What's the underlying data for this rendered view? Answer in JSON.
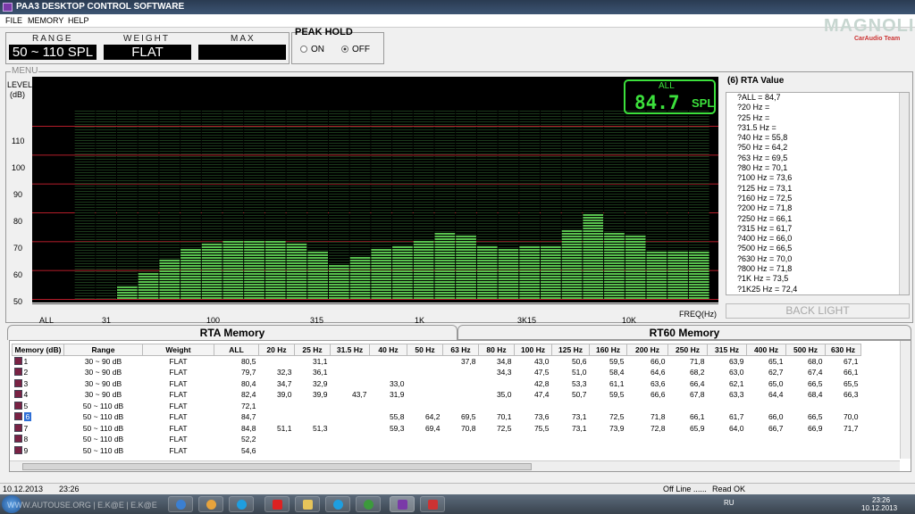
{
  "window": {
    "title": "PAA3 DESKTOP CONTROL SOFTWARE"
  },
  "menu": {
    "items": [
      "FILE",
      "MEMORY",
      "HELP"
    ]
  },
  "logo": {
    "brand": "MAGNOLIA",
    "sub": "CarAudio Team"
  },
  "top": {
    "range_label": "RANGE",
    "range_value": "50 ~ 110 SPL",
    "weight_label": "WEIGHT",
    "weight_value": "FLAT",
    "max_label": "MAX",
    "max_value": ""
  },
  "peak_hold": {
    "title": "PEAK HOLD",
    "on_label": "ON",
    "off_label": "OFF",
    "selected": "OFF"
  },
  "menu_group_label": "MENU",
  "graph": {
    "level_label": "LEVEL",
    "unit_label": "(dB)",
    "y_ticks": [
      "110",
      "100",
      "90",
      "80",
      "70",
      "60",
      "50"
    ],
    "freq_label": "FREQ(Hz)",
    "x_ticks": [
      "ALL",
      "31",
      "100",
      "315",
      "1K",
      "3K15",
      "10K"
    ],
    "colors": {
      "bar": "#59c24f",
      "line": "#b51d2a",
      "bg": "#000000"
    }
  },
  "spl_display": {
    "mode": "ALL",
    "value": "84.7",
    "unit": "SPL"
  },
  "chart_data": {
    "type": "bar",
    "ylim": [
      50,
      110
    ],
    "ylabel": "(dB)",
    "xlabel": "FREQ(Hz)",
    "bands_db": [
      54.6,
      58.4,
      63.0,
      67.2,
      69.1,
      70.4,
      70.4,
      69.5,
      68.6,
      66.2,
      61.5,
      64.5,
      67.1,
      68.1,
      69.8,
      72.4,
      71.7,
      68.2,
      67.3,
      67.8,
      67.9,
      73.2,
      79.5,
      72.9,
      72.1,
      66.7,
      66.6,
      66.5
    ]
  },
  "rta_value": {
    "title": "(6) RTA Value",
    "lines": [
      "?ALL =   84,7",
      "?20 Hz =",
      "?25 Hz =",
      "?31.5 Hz =",
      "?40 Hz =    55,8",
      "?50 Hz =    64,2",
      "?63 Hz =    69,5",
      "?80 Hz =    70,1",
      "?100 Hz =    73,6",
      "?125 Hz =    73,1",
      "?160 Hz =    72,5",
      "?200 Hz =    71,8",
      "?250 Hz =    66,1",
      "?315 Hz =    61,7",
      "?400 Hz =    66,0",
      "?500 Hz =    66,5",
      "?630 Hz =    70,0",
      "?800 Hz =    71,8",
      "?1K Hz =    73,5",
      "?1K25 Hz =    72,4"
    ]
  },
  "back_light": "BACK LIGHT",
  "tabs": {
    "rta": "RTA Memory",
    "rt60": "RT60 Memory"
  },
  "table": {
    "headers": [
      "Memory   (dB)",
      "Range",
      "Weight",
      "ALL",
      "20 Hz",
      "25 Hz",
      "31.5 Hz",
      "40 Hz",
      "50 Hz",
      "63 Hz",
      "80 Hz",
      "100 Hz",
      "125 Hz",
      "160 Hz",
      "200 Hz",
      "250 Hz",
      "315 Hz",
      "400 Hz",
      "500 Hz",
      "630 Hz"
    ],
    "rows": [
      [
        "1",
        "30 ~ 90 dB",
        "FLAT",
        "80,5",
        "",
        "31,1",
        "",
        "",
        "",
        "37,8",
        "34,8",
        "43,0",
        "50,6",
        "59,5",
        "66,0",
        "71,8",
        "63,9",
        "65,1",
        "68,0",
        "67,1"
      ],
      [
        "2",
        "30 ~ 90 dB",
        "FLAT",
        "79,7",
        "32,3",
        "36,1",
        "",
        "",
        "",
        "",
        "34,3",
        "47,5",
        "51,0",
        "58,4",
        "64,6",
        "68,2",
        "63,0",
        "62,7",
        "67,4",
        "66,1"
      ],
      [
        "3",
        "30 ~ 90 dB",
        "FLAT",
        "80,4",
        "34,7",
        "32,9",
        "",
        "33,0",
        "",
        "",
        "",
        "42,8",
        "53,3",
        "61,1",
        "63,6",
        "66,4",
        "62,1",
        "65,0",
        "66,5",
        "65,5"
      ],
      [
        "4",
        "30 ~ 90 dB",
        "FLAT",
        "82,4",
        "39,0",
        "39,9",
        "43,7",
        "31,9",
        "",
        "",
        "35,0",
        "47,4",
        "50,7",
        "59,5",
        "66,6",
        "67,8",
        "63,3",
        "64,4",
        "68,4",
        "66,3"
      ],
      [
        "5",
        "50 ~ 110 dB",
        "FLAT",
        "72,1",
        "",
        "",
        "",
        "",
        "",
        "",
        "",
        "",
        "",
        "",
        "",
        "",
        "",
        "",
        "",
        ""
      ],
      [
        "6",
        "50 ~ 110 dB",
        "FLAT",
        "84,7",
        "",
        "",
        "",
        "55,8",
        "64,2",
        "69,5",
        "70,1",
        "73,6",
        "73,1",
        "72,5",
        "71,8",
        "66,1",
        "61,7",
        "66,0",
        "66,5",
        "70,0"
      ],
      [
        "7",
        "50 ~ 110 dB",
        "FLAT",
        "84,8",
        "51,1",
        "51,3",
        "",
        "59,3",
        "69,4",
        "70,8",
        "72,5",
        "75,5",
        "73,1",
        "73,9",
        "72,8",
        "65,9",
        "64,0",
        "66,7",
        "66,9",
        "71,7"
      ],
      [
        "8",
        "50 ~ 110 dB",
        "FLAT",
        "52,2",
        "",
        "",
        "",
        "",
        "",
        "",
        "",
        "",
        "",
        "",
        "",
        "",
        "",
        "",
        "",
        ""
      ],
      [
        "9",
        "50 ~ 110 dB",
        "FLAT",
        "54,6",
        "",
        "",
        "",
        "",
        "",
        "",
        "",
        "",
        "",
        "",
        "",
        "",
        "",
        "",
        "",
        ""
      ]
    ],
    "selected_row": "6"
  },
  "status": {
    "date": "10.12.2013",
    "time": "23:26",
    "conn": "Off Line ......",
    "state": "Read OK"
  },
  "taskbar": {
    "watermark": "WWW.AUTOUSE.ORG | E.K@E | E.K@E",
    "lang": "RU",
    "clock_time": "23:26",
    "clock_date": "10.12.2013"
  }
}
